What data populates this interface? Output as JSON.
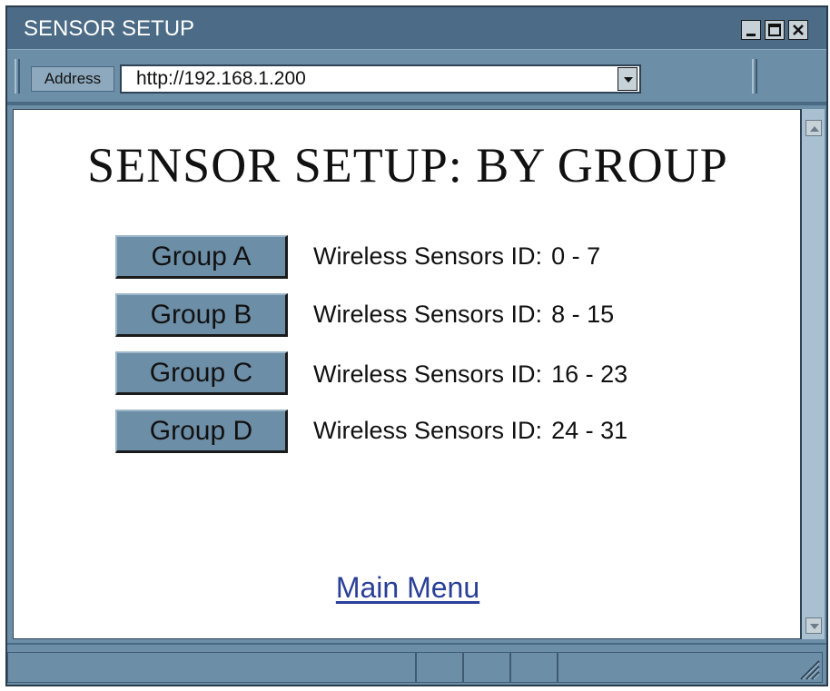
{
  "window": {
    "title": "SENSOR SETUP"
  },
  "address_bar": {
    "label": "Address",
    "url": "http://192.168.1.200"
  },
  "page": {
    "title": "SENSOR SETUP: BY GROUP",
    "groups": [
      {
        "button": "Group A",
        "label": "Wireless Sensors ID:",
        "range": "0 - 7"
      },
      {
        "button": "Group B",
        "label": "Wireless Sensors ID:",
        "range": "8 - 15"
      },
      {
        "button": "Group C",
        "label": "Wireless Sensors ID:",
        "range": "16 - 23"
      },
      {
        "button": "Group D",
        "label": "Wireless Sensors ID:",
        "range": "24 - 31"
      }
    ],
    "main_menu_link": "Main Menu"
  },
  "colors": {
    "chrome": "#6d8ea7",
    "titlebar": "#4b6b86",
    "link": "#2a3f98"
  },
  "icons": [
    "minimize-icon",
    "maximize-icon",
    "close-icon",
    "dropdown-arrow-icon",
    "scroll-up-icon",
    "scroll-down-icon",
    "resize-grip-icon"
  ]
}
